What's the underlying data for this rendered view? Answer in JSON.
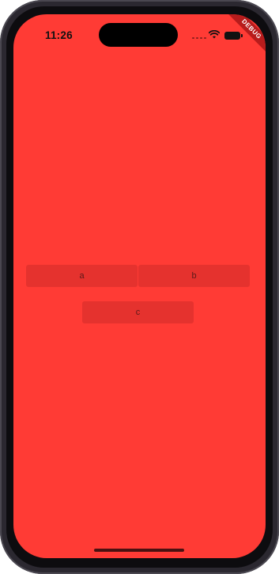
{
  "status_bar": {
    "time": "11:26",
    "debug_banner": "DEBUG"
  },
  "colors": {
    "screen_background": "#ff3b35",
    "button_text": "#5a1a1a"
  },
  "buttons": {
    "a_label": "a",
    "b_label": "b",
    "c_label": "c"
  }
}
